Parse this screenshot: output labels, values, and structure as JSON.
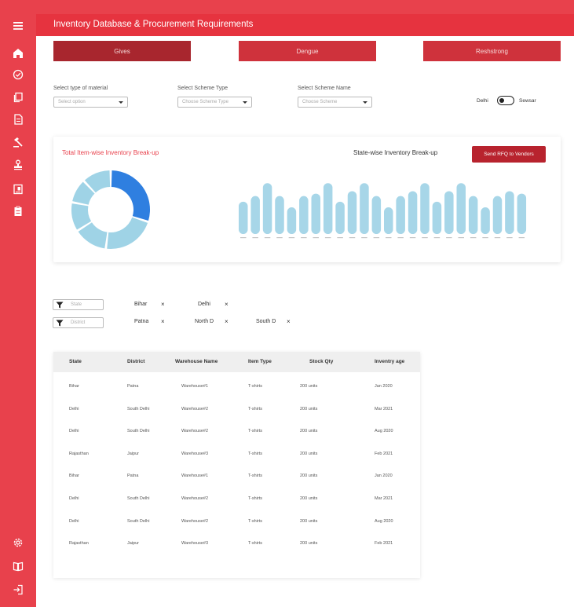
{
  "header": {
    "title": "Inventory Database & Procurement Requirements"
  },
  "tabs": [
    {
      "label": "Gives",
      "active": true
    },
    {
      "label": "Dengue",
      "active": false
    },
    {
      "label": "Reshstrong",
      "active": false
    }
  ],
  "filters": {
    "material": {
      "label": "Select type of material",
      "placeholder": "Select option"
    },
    "scheme_type": {
      "label": "Select Scheme Type",
      "placeholder": "Choose Scheme Type"
    },
    "scheme_name": {
      "label": "Select Scheme Name",
      "placeholder": "Choose Scheme"
    }
  },
  "toggle": {
    "left_label": "Delhi",
    "right_label": "Sewsar"
  },
  "donut_card": {
    "title": "Total Item-wise Inventory Break-up"
  },
  "bar_card": {
    "title": "State-wise Inventory Break-up",
    "button": "Send RFQ to Vendors"
  },
  "chart_data": [
    {
      "type": "pie",
      "title": "Total Item-wise Inventory Break-up",
      "values": [
        30,
        22,
        14,
        12,
        10,
        12
      ],
      "highlight_index": 0
    },
    {
      "type": "bar",
      "title": "State-wise Inventory Break-up",
      "values": [
        40,
        47,
        63,
        47,
        33,
        47,
        50,
        63,
        40,
        53,
        63,
        47,
        33,
        47,
        53,
        63,
        40,
        53,
        63,
        47,
        33,
        47,
        53,
        50
      ],
      "ylim": [
        0,
        70
      ]
    }
  ],
  "chip_filters": {
    "state": {
      "placeholder": "State",
      "chips": [
        "Bihar",
        "Delhi"
      ]
    },
    "district": {
      "placeholder": "District",
      "chips": [
        "Patna",
        "North D",
        "South D"
      ]
    }
  },
  "table": {
    "columns": [
      "State",
      "District",
      "Warehouse Name",
      "Item Type",
      "Stock Qty",
      "Inventry age"
    ],
    "rows": [
      [
        "Bihar",
        "Patna",
        "Warehouse#1",
        "T-shirts",
        "200 units",
        "Jan 2020"
      ],
      [
        "Delhi",
        "South Delhi",
        "Warehouse#2",
        "T-shirts",
        "200 units",
        "Mar 2021"
      ],
      [
        "Delhi",
        "South Delhi",
        "Warehouse#2",
        "T-shirts",
        "200 units",
        "Aug 2020"
      ],
      [
        "Rajasthan",
        "Jaipur",
        "Warehouse#3",
        "T-shirts",
        "200 units",
        "Feb 2021"
      ],
      [
        "Bihar",
        "Patna",
        "Warehouse#1",
        "T-shirts",
        "200 units",
        "Jan 2020"
      ],
      [
        "Delhi",
        "South Delhi",
        "Warehouse#2",
        "T-shirts",
        "200 units",
        "Mar 2021"
      ],
      [
        "Delhi",
        "South Delhi",
        "Warehouse#2",
        "T-shirts",
        "200 units",
        "Aug 2020"
      ],
      [
        "Rajasthan",
        "Jaipur",
        "Warehouse#3",
        "T-shirts",
        "200 units",
        "Feb 2021"
      ]
    ]
  },
  "colors": {
    "brand": "#e8414c",
    "header": "#e6333f",
    "tab_active": "#a8262e",
    "tab_inactive": "#cf323c",
    "donut_light": "#9fd3e6",
    "donut_highlight": "#2f7fe0",
    "bar": "#a7d6e8"
  },
  "sidebar_icons": [
    "menu-icon",
    "home-icon",
    "check-circle-icon",
    "copy-icon",
    "document-icon",
    "hammer-icon",
    "stamp-icon",
    "invoice-icon",
    "clipboard-icon",
    "settings-icon",
    "book-icon",
    "logout-icon"
  ]
}
